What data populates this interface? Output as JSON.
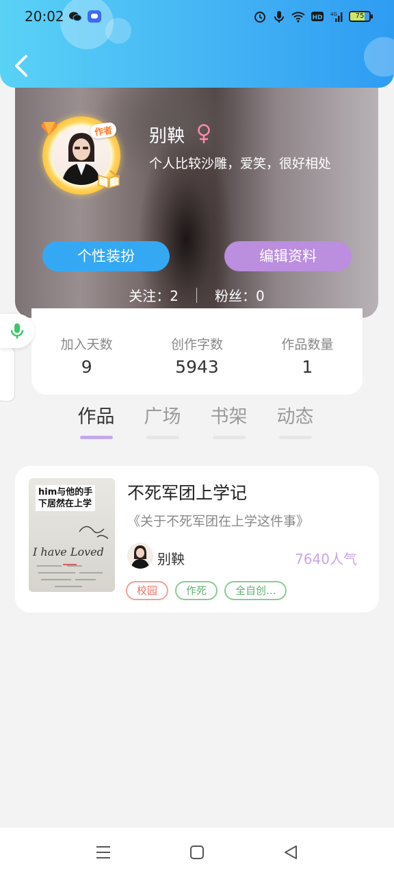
{
  "status_bar": {
    "time": "20:02",
    "battery": "75"
  },
  "profile": {
    "badge": "作者",
    "name": "别鞅",
    "bio": "个人比较沙雕，爱笑，很好相处",
    "dress_up_label": "个性装扮",
    "edit_label": "编辑资料",
    "following_label": "关注：",
    "following_count": "2",
    "followers_label": "粉丝：",
    "followers_count": "0"
  },
  "stats": [
    {
      "label": "加入天数",
      "value": "9"
    },
    {
      "label": "创作字数",
      "value": "5943"
    },
    {
      "label": "作品数量",
      "value": "1"
    }
  ],
  "tabs": [
    {
      "label": "作品",
      "active": true
    },
    {
      "label": "广场",
      "active": false
    },
    {
      "label": "书架",
      "active": false
    },
    {
      "label": "动态",
      "active": false
    }
  ],
  "works": [
    {
      "cover_caption_line1": "him与他的手",
      "cover_caption_line2": "下居然在上学",
      "cover_handwriting": "I have Loved",
      "title": "不死军团上学记",
      "description": "《关于不死军团在上学这件事》",
      "author": "别鞅",
      "popularity": "7640人气",
      "tags": [
        {
          "label": "校园",
          "color": "#ee7466"
        },
        {
          "label": "作死",
          "color": "#62b270"
        },
        {
          "label": "全自创...",
          "color": "#62b270"
        }
      ]
    }
  ],
  "colors": {
    "header_start": "#59d2f6",
    "header_end": "#2e9cf2",
    "accent_blue": "#35a8f4",
    "accent_purple": "#bb8ee0",
    "gender_pink": "#ff8ab0"
  },
  "icons": {
    "back": "chevron-left-icon",
    "gender": "female-icon",
    "mic": "microphone-icon",
    "nav": [
      "menu-icon",
      "home-square-icon",
      "back-triangle-icon"
    ]
  }
}
